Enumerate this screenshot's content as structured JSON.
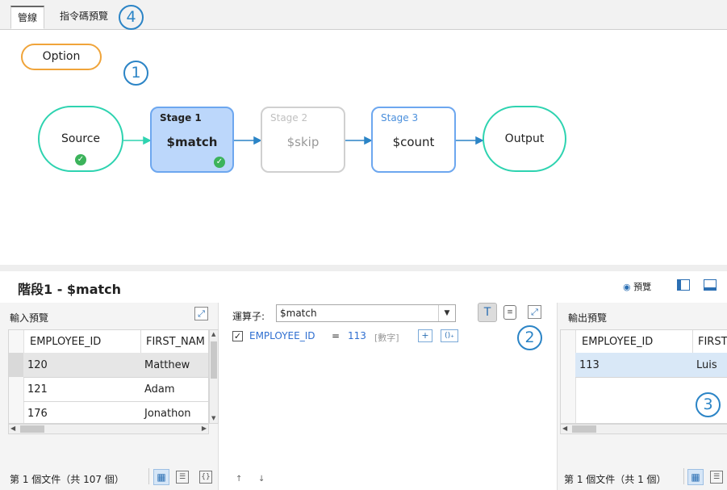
{
  "tabs": {
    "pipeline": "管線",
    "code_preview": "指令碼預覽"
  },
  "callouts": {
    "c1": "1",
    "c2": "2",
    "c3": "3",
    "c4": "4"
  },
  "option_button": "Option",
  "pipeline": {
    "source": "Source",
    "stage1": {
      "title": "Stage 1",
      "op": "$match"
    },
    "stage2": {
      "title": "Stage 2",
      "op": "$skip"
    },
    "stage3": {
      "title": "Stage 3",
      "op": "$count"
    },
    "output": "Output"
  },
  "stage_panel": {
    "title": "階段1 - $match",
    "preview_label": "預覽"
  },
  "input_preview": {
    "title": "輸入預覽",
    "columns": [
      "EMPLOYEE_ID",
      "FIRST_NAM"
    ],
    "rows": [
      [
        "120",
        "Matthew"
      ],
      [
        "121",
        "Adam"
      ],
      [
        "176",
        "Jonathon"
      ]
    ],
    "footer": "第 1 個文件（共 107 個）"
  },
  "operator": {
    "label": "運算子:",
    "value": "$match",
    "condition_field": "EMPLOYEE_ID",
    "condition_op": "=",
    "condition_value": "113",
    "condition_type": "[數字]"
  },
  "output_preview": {
    "title": "輸出預覽",
    "columns": [
      "EMPLOYEE_ID",
      "FIRST"
    ],
    "rows": [
      [
        "113",
        "Luis"
      ]
    ],
    "footer": "第 1 個文件（共 1 個）"
  },
  "colors": {
    "accent": "#2b84c6",
    "source_border": "#2ed3b0",
    "option_border": "#f0a43a",
    "stage_active": "#bcd7fb",
    "check": "#3cb35b"
  }
}
